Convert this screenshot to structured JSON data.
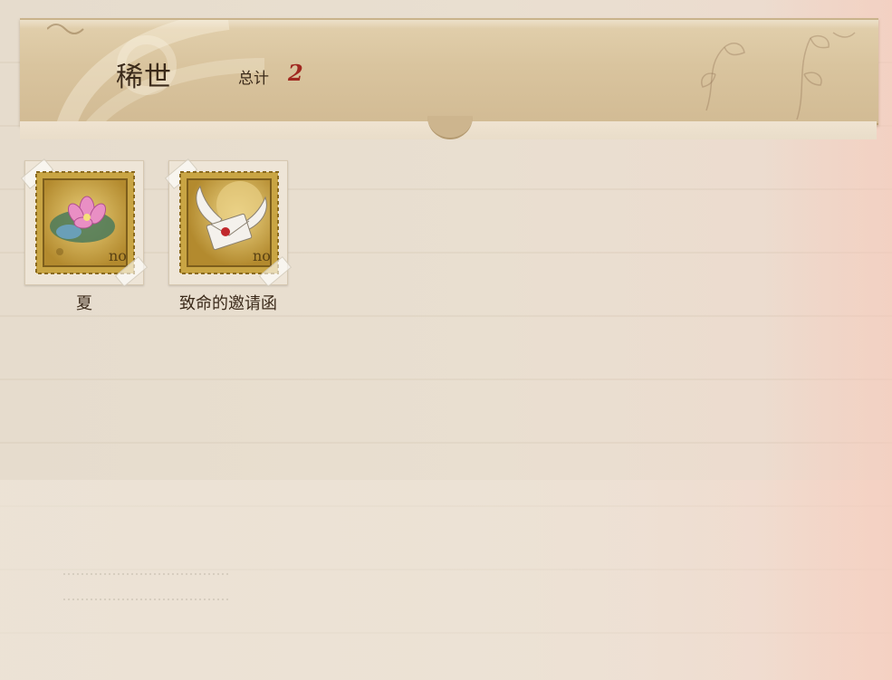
{
  "header": {
    "rarity_title": "稀世",
    "total_label": "总计",
    "total_count": "2"
  },
  "stamps": [
    {
      "name": "夏",
      "icon": "lotus-stamp-icon"
    },
    {
      "name": "致命的邀请函",
      "icon": "winged-letter-stamp-icon"
    }
  ],
  "colors": {
    "banner": "#d9c49e",
    "title_text": "#3b2a1a",
    "count_text": "#a02820",
    "stamp_gold": "#c9a544"
  }
}
